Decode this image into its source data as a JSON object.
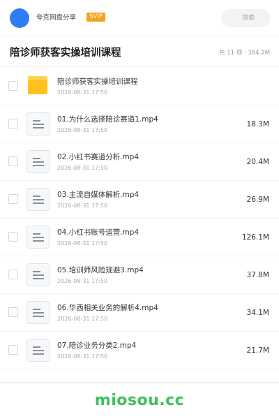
{
  "header": {
    "uploader": "夸克网盘分享",
    "badge": "SVIP",
    "search_placeholder": "搜索"
  },
  "folder": {
    "title": "陪诊师获客实操培训课程",
    "summary": "共 11 项 · 364.2M"
  },
  "files": [
    {
      "type": "folder",
      "name": "陪诊师获客实操培训课程",
      "date": "2026-08-31 17:50",
      "size": ""
    },
    {
      "type": "file",
      "name": "01.为什么选择陪诊赛道1.mp4",
      "date": "2026-08-31 17:50",
      "size": "18.3M"
    },
    {
      "type": "file",
      "name": "02.小红书赛道分析.mp4",
      "date": "2026-08-31 17:50",
      "size": "20.4M"
    },
    {
      "type": "file",
      "name": "03.主流自媒体解析.mp4",
      "date": "2026-08-31 17:50",
      "size": "26.9M"
    },
    {
      "type": "file",
      "name": "04.小红书账号运营.mp4",
      "date": "2026-08-31 17:50",
      "size": "126.1M"
    },
    {
      "type": "file",
      "name": "05.培训师风险规避3.mp4",
      "date": "2026-08-31 17:50",
      "size": "37.8M"
    },
    {
      "type": "file",
      "name": "06.华西相关业务的解析4.mp4",
      "date": "2026-08-31 17:50",
      "size": "34.1M"
    },
    {
      "type": "file",
      "name": "07.陪诊业务分类2.mp4",
      "date": "2026-08-31 17:50",
      "size": "21.7M"
    }
  ],
  "footer": {
    "site": "miosou.cc"
  },
  "colors": {
    "avatar": "#2f7df6",
    "badge": "#f7a21d",
    "folder": "#ffc21c",
    "site_logo": "#3cc25b"
  },
  "icons": {
    "folder": "folder-icon",
    "file": "file-doc-icon"
  }
}
